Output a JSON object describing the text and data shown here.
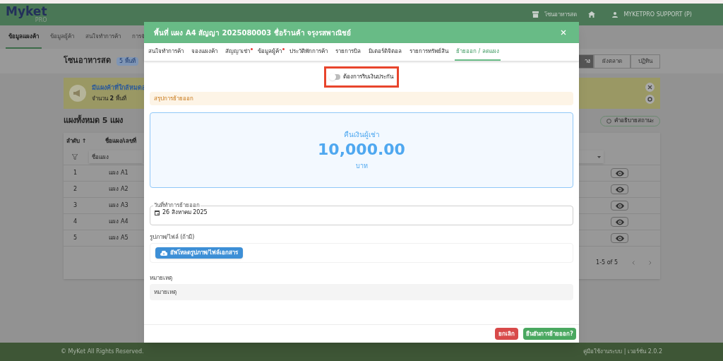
{
  "app": {
    "logo": "Myket",
    "logo_sub": "PRO",
    "zone": "โซนอาหารสด",
    "user": "MYKETPRO SUPPORT (P)"
  },
  "nav": [
    {
      "label": "ข้อมูลแผงค้า",
      "selected": true
    },
    {
      "label": "ข้อมูลผู้ค้า",
      "selected": false
    },
    {
      "label": "สนใจทำการค้า",
      "selected": false
    },
    {
      "label": "การจั",
      "selected": false
    }
  ],
  "zone_title": "โซนอาหารสด",
  "zone_badge": "5 พื้นที่",
  "view_buttons": [
    {
      "label": "าง",
      "selected": true
    },
    {
      "label": "ผังตลาด",
      "selected": false
    },
    {
      "label": "ปฏิทิน",
      "selected": false
    }
  ],
  "banner": {
    "title": "มีแผงค้าที่ใกล้หมดอ",
    "text": "จำนวน **2** พื้นที่"
  },
  "stalls_title": "แผงทั้งหมด 5 แผง",
  "status_help": "คำอธิบายสถานะ",
  "table": {
    "columns": [
      "ลำดับ ↑",
      "ชื่อแผง/เลขที่"
    ],
    "filter_placeholder": "ชื่อแผง",
    "rows": [
      {
        "no": "1",
        "name": "แผง A1"
      },
      {
        "no": "2",
        "name": "แผง A2"
      },
      {
        "no": "3",
        "name": "แผง A3"
      },
      {
        "no": "4",
        "name": "แผง A4"
      },
      {
        "no": "5",
        "name": "แผง A5"
      }
    ],
    "pagination": "1-5 of 5"
  },
  "footer": {
    "copyright": "© MyKet All Rights Reserved.",
    "version": "คู่มือใช้งานระบบ | เวอร์ชั่น 2.0.2"
  },
  "dialog": {
    "title": "พื้นที่ แผง A4 สัญญา 2025080003 ชื่อร้านค้า จรุงรสพาณิชย์",
    "tabs": [
      {
        "label": "สนใจทำการค้า",
        "selected": false,
        "alert": false
      },
      {
        "label": "จองแผงค้า",
        "selected": false,
        "alert": false
      },
      {
        "label": "สัญญาเช่า",
        "selected": false,
        "alert": true
      },
      {
        "label": "ข้อมูลผู้ค้า",
        "selected": false,
        "alert": true
      },
      {
        "label": "ประวัติพักการค้า",
        "selected": false,
        "alert": false
      },
      {
        "label": "รายการบิล",
        "selected": false,
        "alert": false
      },
      {
        "label": "มิเตอร์ดิจิตอล",
        "selected": false,
        "alert": false
      },
      {
        "label": "รายการทรัพย์สิน",
        "selected": false,
        "alert": false
      },
      {
        "label": "ย้ายออก / ลดแผง",
        "selected": true,
        "alert": false
      }
    ],
    "deposit_toggle": {
      "label": "ต้องการริบเงินประกัน",
      "on": false,
      "highlighted": true
    },
    "summary": "สรุปการย้ายออก",
    "refund": {
      "label": "คืนเงินผู้เช่า",
      "amount": "10,000.00",
      "unit": "บาท"
    },
    "move_date": {
      "label": "วันที่ทำการย้ายออก",
      "value": "26 สิงหาคม 2025"
    },
    "upload": {
      "label": "รูปภาพ/ไฟล์ (ถ้ามี)",
      "button": "อัพโหลดรูปภาพ/ไฟล์เอกสาร"
    },
    "note": {
      "label": "หมายเหตุ",
      "placeholder": "หมายเหตุ"
    },
    "buttons": {
      "cancel": "ยกเลิก",
      "confirm": "ยืนยันการย้ายออก?"
    }
  }
}
